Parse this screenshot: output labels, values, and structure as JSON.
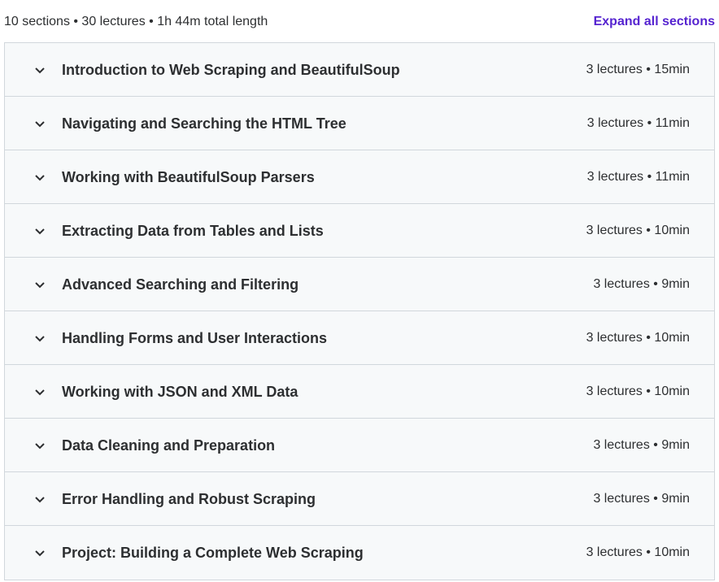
{
  "summary": {
    "text": "10 sections • 30 lectures • 1h 44m total length",
    "expand_label": "Expand all sections"
  },
  "sections": [
    {
      "title": "Introduction to Web Scraping and BeautifulSoup",
      "meta": "3 lectures • 15min"
    },
    {
      "title": "Navigating and Searching the HTML Tree",
      "meta": "3 lectures • 11min"
    },
    {
      "title": "Working with BeautifulSoup Parsers",
      "meta": "3 lectures • 11min"
    },
    {
      "title": "Extracting Data from Tables and Lists",
      "meta": "3 lectures • 10min"
    },
    {
      "title": "Advanced Searching and Filtering",
      "meta": "3 lectures • 9min"
    },
    {
      "title": "Handling Forms and User Interactions",
      "meta": "3 lectures • 10min"
    },
    {
      "title": "Working with JSON and XML Data",
      "meta": "3 lectures • 10min"
    },
    {
      "title": "Data Cleaning and Preparation",
      "meta": "3 lectures • 9min"
    },
    {
      "title": "Error Handling and Robust Scraping",
      "meta": "3 lectures • 9min"
    },
    {
      "title": "Project: Building a Complete Web Scraping",
      "meta": "3 lectures • 10min"
    }
  ],
  "icons": {
    "section_toggle": "chevron-down-icon"
  },
  "colors": {
    "accent": "#5624d0",
    "text": "#2d2f31",
    "row_background": "#f7f9fa",
    "border": "#d1d7dc"
  }
}
